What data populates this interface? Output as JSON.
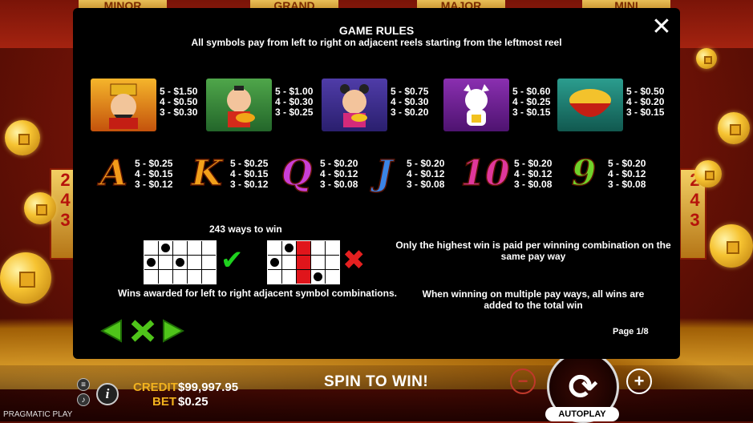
{
  "background": {
    "jackpots": [
      "MINOR",
      "GRAND",
      "MAJOR",
      "MINI"
    ],
    "ways_badge": "243"
  },
  "rules_panel": {
    "title": "GAME RULES",
    "subtitle": "All symbols pay from left to right on adjacent reels starting from the leftmost reel",
    "close_icon": "close-icon",
    "high_symbols": [
      {
        "name": "god-of-wealth",
        "pays": [
          "5 - $1.50",
          "4 - $0.50",
          "3 - $0.30"
        ]
      },
      {
        "name": "boy-with-fish",
        "pays": [
          "5 - $1.00",
          "4 - $0.30",
          "3 - $0.25"
        ]
      },
      {
        "name": "girl-with-gold",
        "pays": [
          "5 - $0.75",
          "4 - $0.30",
          "3 - $0.20"
        ]
      },
      {
        "name": "lucky-cat",
        "pays": [
          "5 - $0.60",
          "4 - $0.25",
          "3 - $0.15"
        ]
      },
      {
        "name": "gold-bowl",
        "pays": [
          "5 - $0.50",
          "4 - $0.20",
          "3 - $0.15"
        ]
      }
    ],
    "low_symbols": [
      {
        "label": "A",
        "color": "#f29a1a",
        "pays": [
          "5 - $0.25",
          "4 - $0.15",
          "3 - $0.12"
        ]
      },
      {
        "label": "K",
        "color": "#f2a01a",
        "pays": [
          "5 - $0.25",
          "4 - $0.15",
          "3 - $0.12"
        ]
      },
      {
        "label": "Q",
        "color": "#c93fd6",
        "pays": [
          "5 - $0.20",
          "4 - $0.12",
          "3 - $0.08"
        ]
      },
      {
        "label": "J",
        "color": "#3b84e6",
        "pays": [
          "5 - $0.20",
          "4 - $0.12",
          "3 - $0.08"
        ]
      },
      {
        "label": "10",
        "color": "#e0379c",
        "pays": [
          "5 - $0.20",
          "4 - $0.12",
          "3 - $0.08"
        ]
      },
      {
        "label": "9",
        "color": "#6fd12a",
        "pays": [
          "5 - $0.20",
          "4 - $0.12",
          "3 - $0.08"
        ]
      }
    ],
    "ways_title": "243 ways to win",
    "ways_text": "Wins awarded for left to right adjacent symbol combinations.",
    "rule_highest": "Only the highest win is paid per winning combination on the same pay way",
    "rule_multiple": "When winning on multiple pay ways, all wins are added to the total win",
    "page": "Page 1/8"
  },
  "bottom_bar": {
    "credit_label": "CREDIT",
    "credit_value": "$99,997.95",
    "bet_label": "BET",
    "bet_value": "$0.25",
    "spin_prompt": "SPIN TO WIN!",
    "autoplay_label": "AUTOPLAY",
    "brand": "PRAGMATIC PLAY",
    "minus": "−",
    "plus": "+",
    "info": "i"
  }
}
